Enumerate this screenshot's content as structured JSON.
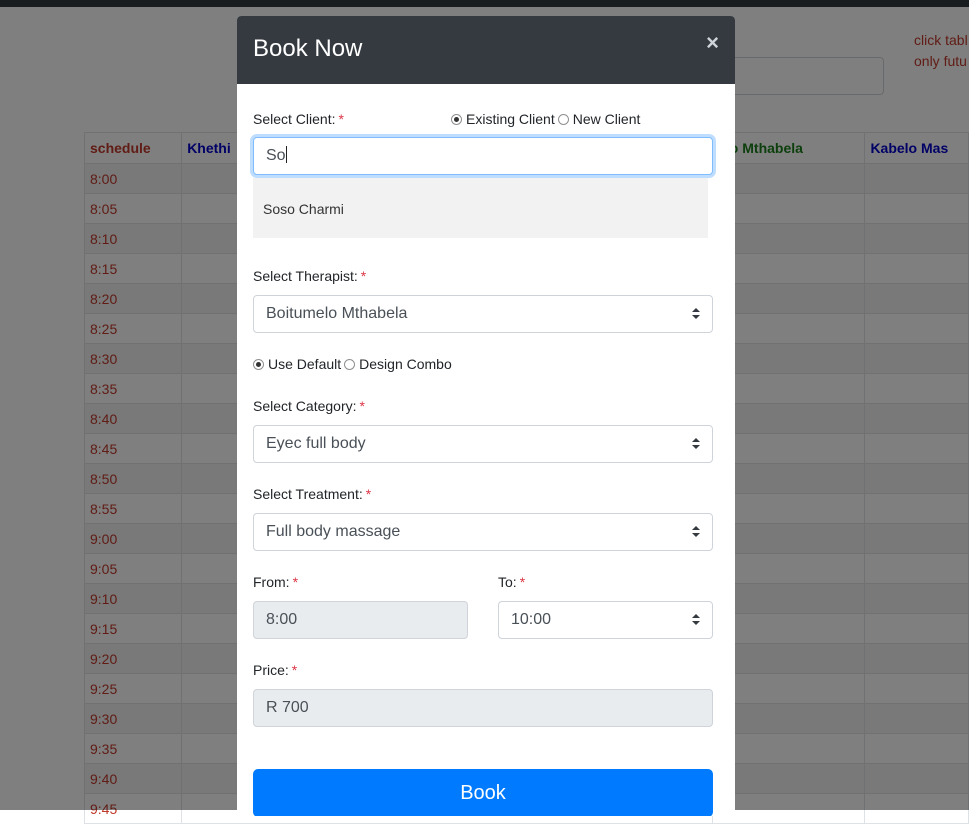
{
  "background": {
    "notice_lines": [
      "click tabl",
      "only futu"
    ],
    "table": {
      "headers": [
        "schedule",
        "Khethi",
        "elo Mthabela",
        "Kabelo Mas"
      ],
      "times": [
        "8:00",
        "8:05",
        "8:10",
        "8:15",
        "8:20",
        "8:25",
        "8:30",
        "8:35",
        "8:40",
        "8:45",
        "8:50",
        "8:55",
        "9:00",
        "9:05",
        "9:10",
        "9:15",
        "9:20",
        "9:25",
        "9:30",
        "9:35",
        "9:40",
        "9:45"
      ]
    }
  },
  "modal": {
    "title": "Book Now",
    "close_symbol": "×",
    "client": {
      "label": "Select Client:",
      "required_mark": "*",
      "options": [
        "Existing Client",
        "New Client"
      ],
      "selected": "Existing Client",
      "search_value": "So",
      "suggestions": [
        "Soso Charmi"
      ]
    },
    "therapist": {
      "label": "Select Therapist:",
      "required_mark": "*",
      "value": "Boitumelo Mthabela"
    },
    "combo": {
      "options": [
        "Use Default",
        "Design Combo"
      ],
      "selected": "Use Default"
    },
    "category": {
      "label": "Select Category:",
      "required_mark": "*",
      "value": "Eyec full body"
    },
    "treatment": {
      "label": "Select Treatment:",
      "required_mark": "*",
      "value": "Full body massage"
    },
    "from": {
      "label": "From:",
      "required_mark": "*",
      "value": "8:00"
    },
    "to": {
      "label": "To:",
      "required_mark": "*",
      "value": "10:00"
    },
    "price": {
      "label": "Price:",
      "required_mark": "*",
      "value": "R 700"
    },
    "submit_label": "Book"
  },
  "colors": {
    "header_bg": "#343a40",
    "primary": "#007bff",
    "required": "#dc3545",
    "time_text": "#c0392b"
  },
  "icons": {
    "close": "close-icon",
    "select_arrows": "select-arrows-icon"
  }
}
